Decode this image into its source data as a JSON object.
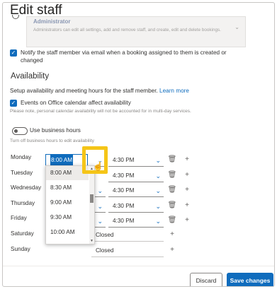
{
  "header": {
    "title": "Edit staff"
  },
  "role": {
    "name": "Administrator",
    "description": "Administrators can edit all settings, add and remove staff, and create, edit and delete bookings."
  },
  "notify": {
    "checked": true,
    "label_line1": "Notify the staff member via email when a booking assigned to them is created or",
    "label_line2": "changed"
  },
  "availability": {
    "heading": "Availability",
    "description": "Setup availability and meeting hours for the staff member.",
    "learn_more": "Learn more",
    "office_calendar": {
      "checked": true,
      "label": "Events on Office calendar affect availability",
      "note": "Please note, personal calendar availability will not be accounted for in multi-day services."
    },
    "business_hours": {
      "label": "Use business hours",
      "on": false,
      "note": "Turn off business hours to edit availability"
    },
    "days": [
      {
        "name": "Monday",
        "start": "8:00 AM",
        "end": "4:30 PM"
      },
      {
        "name": "Tuesday",
        "start": "8:00 AM",
        "end": "4:30 PM"
      },
      {
        "name": "Wednesday",
        "start": "",
        "end": "4:30 PM"
      },
      {
        "name": "Thursday",
        "start": "",
        "end": "4:30 PM"
      },
      {
        "name": "Friday",
        "start": "",
        "end": "4:30 PM"
      },
      {
        "name": "Saturday",
        "status": "Closed"
      },
      {
        "name": "Sunday",
        "status": "Closed"
      }
    ],
    "dropdown_options": [
      "8:00 AM",
      "8:30 AM",
      "9:00 AM",
      "9:30 AM",
      "10:00 AM"
    ]
  },
  "footer": {
    "discard": "Discard",
    "save": "Save changes"
  },
  "colors": {
    "accent": "#0f6cbd",
    "highlight": "#f5c518"
  }
}
